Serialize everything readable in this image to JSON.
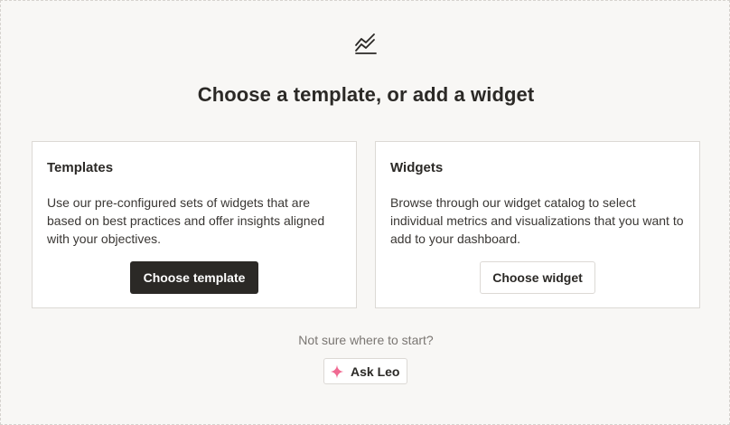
{
  "page": {
    "heading": "Choose a template, or add a widget",
    "top_icon": "chart-trend-icon"
  },
  "templates_card": {
    "title": "Templates",
    "description": "Use our pre-configured sets of widgets that are based on best practices and offer insights aligned with your objectives.",
    "button_label": "Choose template"
  },
  "widgets_card": {
    "title": "Widgets",
    "description": "Browse through our widget catalog to select individual metrics and visualizations that you want to add to your dashboard.",
    "button_label": "Choose widget"
  },
  "help": {
    "hint": "Not sure where to start?",
    "ask_label": "Ask Leo",
    "ask_icon": "sparkle-icon"
  },
  "colors": {
    "background": "#f8f7f5",
    "primary_button": "#2b2926",
    "sparkle": "#f06a92",
    "border": "#dcd9d5"
  }
}
